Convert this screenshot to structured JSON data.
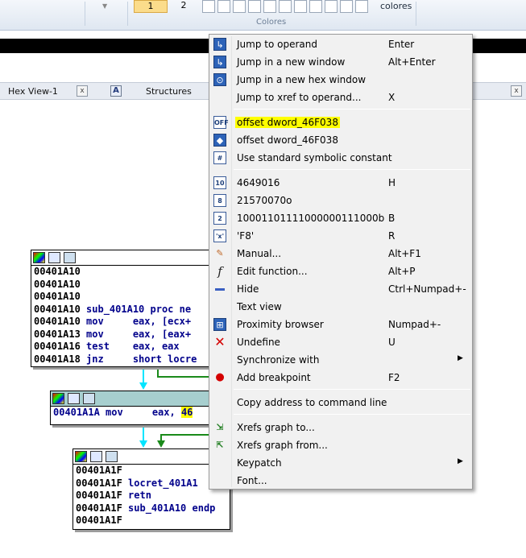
{
  "ribbon": {
    "button1": "1",
    "button2": "2",
    "colores_word": "colores",
    "group_label": "Colores"
  },
  "tabs": [
    {
      "label": "Hex View-1",
      "close": "x"
    },
    {
      "icon": "A",
      "label": "Structures",
      "close": "x"
    }
  ],
  "blocks": {
    "block1": {
      "lines": [
        {
          "addr": "00401A10",
          "code": ""
        },
        {
          "addr": "00401A10",
          "code": ""
        },
        {
          "addr": "00401A10",
          "code": ""
        },
        {
          "addr": "00401A10",
          "code": " sub_401A10 proc ne"
        },
        {
          "addr": "00401A10",
          "code": " mov     eax, [ecx+"
        },
        {
          "addr": "00401A13",
          "code": " mov     eax, [eax+"
        },
        {
          "addr": "00401A16",
          "code": " test    eax, eax"
        },
        {
          "addr": "00401A18",
          "code": " jnz     short locre"
        }
      ]
    },
    "block2": {
      "addr": "00401A1A",
      "code": " mov     eax, ",
      "highlight": "46"
    },
    "block3": {
      "lines": [
        {
          "addr": "00401A1F",
          "code": ""
        },
        {
          "addr": "00401A1F",
          "code": " locret_401A1"
        },
        {
          "addr": "00401A1F",
          "code": " retn"
        },
        {
          "addr": "00401A1F",
          "code": " sub_401A10 endp"
        },
        {
          "addr": "00401A1F",
          "code": ""
        }
      ]
    }
  },
  "menu": {
    "items": [
      {
        "label": "Jump to operand",
        "shortcut": "Enter",
        "icon": "jump-operand-icon"
      },
      {
        "label": "Jump in a new window",
        "shortcut": "Alt+Enter",
        "icon": "new-window-icon"
      },
      {
        "label": "Jump in a new hex window",
        "shortcut": "",
        "icon": "hex-window-icon"
      },
      {
        "label": "Jump to xref to operand...",
        "shortcut": "X",
        "icon": ""
      },
      {
        "label": "offset dword_46F038",
        "shortcut": "",
        "icon": "offset-icon",
        "highlighted": true
      },
      {
        "label": "offset dword_46F038",
        "shortcut": "",
        "icon": "offset-alt-icon"
      },
      {
        "label": "Use standard symbolic constant",
        "shortcut": "",
        "icon": "symbolic-constant-icon"
      },
      {
        "label": "4649016",
        "shortcut": "H",
        "icon": "decimal-icon",
        "icon_text": "10"
      },
      {
        "label": "21570070o",
        "shortcut": "",
        "icon": "octal-icon",
        "icon_text": "8"
      },
      {
        "label": "10001101111000000111000b",
        "shortcut": "B",
        "icon": "binary-icon",
        "icon_text": "2"
      },
      {
        "label": "'F8'",
        "shortcut": "R",
        "icon": "char-icon",
        "icon_text": "'x'"
      },
      {
        "label": "Manual...",
        "shortcut": "Alt+F1",
        "icon": "pencil-icon"
      },
      {
        "label": "Edit function...",
        "shortcut": "Alt+P",
        "icon": "function-icon",
        "icon_text": "f"
      },
      {
        "label": "Hide",
        "shortcut": "Ctrl+Numpad+-",
        "icon": "hide-icon"
      },
      {
        "label": "Text view",
        "shortcut": "",
        "icon": ""
      },
      {
        "label": "Proximity browser",
        "shortcut": "Numpad+-",
        "icon": "proximity-icon"
      },
      {
        "label": "Undefine",
        "shortcut": "U",
        "icon": "undefine-icon",
        "icon_text": "✕"
      },
      {
        "label": "Synchronize with",
        "shortcut": "",
        "icon": "",
        "submenu": true
      },
      {
        "label": "Add breakpoint",
        "shortcut": "F2",
        "icon": "breakpoint-icon"
      },
      {
        "label": "Copy address to command line",
        "shortcut": "",
        "icon": ""
      },
      {
        "label": "Xrefs graph to...",
        "shortcut": "",
        "icon": "xrefs-to-icon"
      },
      {
        "label": "Xrefs graph from...",
        "shortcut": "",
        "icon": "xrefs-from-icon"
      },
      {
        "label": "Keypatch",
        "shortcut": "",
        "icon": "",
        "submenu": true
      },
      {
        "label": "Font...",
        "shortcut": "",
        "icon": ""
      }
    ],
    "submenu_arrow": "▶"
  },
  "colors": {
    "highlight": "#ffff00",
    "menu_bg": "#f1f1f1",
    "block_header_teal": "#a7cfcf",
    "arrow_cyan": "#00e5ff",
    "arrow_green": "#1a8a1a"
  }
}
